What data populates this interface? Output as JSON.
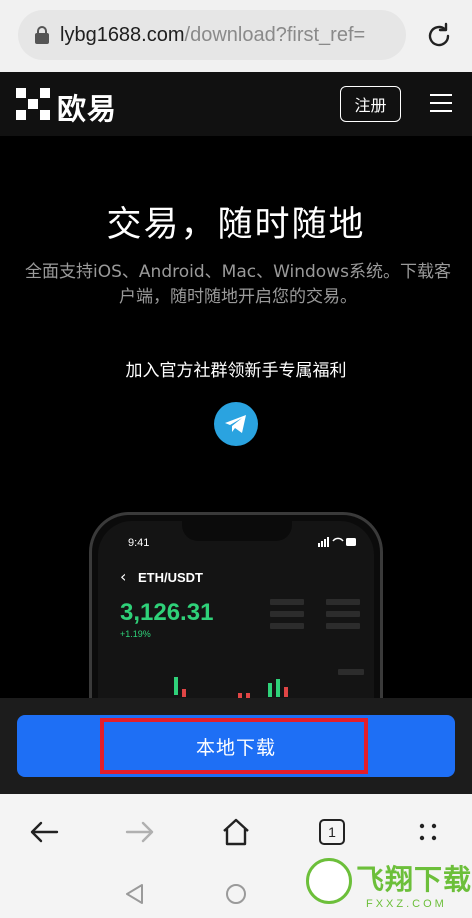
{
  "browser": {
    "url_host": "lybg1688.com",
    "url_path": "/download?first_ref=",
    "tab_count": "1"
  },
  "site": {
    "logo_text": "欧易",
    "register_label": "注册"
  },
  "hero": {
    "title": "交易，随时随地",
    "subtitle": "全面支持iOS、Android、Mac、Windows系统。下载客户端，随时随地开启您的交易。",
    "community": "加入官方社群领新手专属福利"
  },
  "phone": {
    "time": "9:41",
    "pair": "ETH/USDT",
    "price": "3,126.31",
    "change": "+1.19%"
  },
  "download": {
    "label": "本地下载"
  },
  "watermark": {
    "text": "飞翔下载",
    "url": "FXXZ.COM"
  },
  "colors": {
    "accent_blue": "#1e6ff5",
    "price_green": "#2fd179",
    "highlight_red": "#e41e2b",
    "telegram": "#2aa3e0"
  }
}
